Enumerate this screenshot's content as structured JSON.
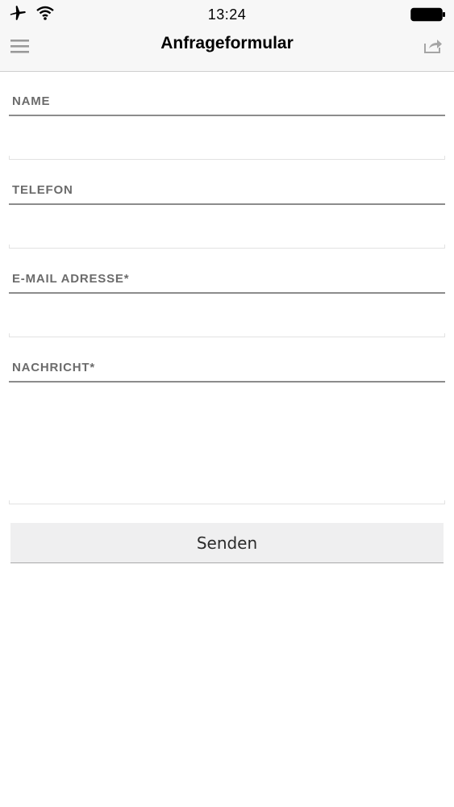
{
  "status_bar": {
    "time": "13:24",
    "airplane_icon": "airplane-icon",
    "wifi_icon": "wifi-icon",
    "battery_icon": "battery-icon"
  },
  "nav": {
    "title": "Anfrageformular",
    "menu_icon": "hamburger-menu-icon",
    "share_icon": "share-icon"
  },
  "form": {
    "fields": [
      {
        "label": "NAME",
        "value": "",
        "placeholder": ""
      },
      {
        "label": "TELEFON",
        "value": "",
        "placeholder": ""
      },
      {
        "label": "E-MAIL ADRESSE*",
        "value": "",
        "placeholder": ""
      },
      {
        "label": "NACHRICHT*",
        "value": "",
        "placeholder": ""
      }
    ],
    "submit_label": "Senden"
  },
  "colors": {
    "label": "#6b6b6b",
    "divider": "#8c8c8c",
    "button_bg": "#efeff0",
    "bar_bg": "#f7f7f7"
  }
}
